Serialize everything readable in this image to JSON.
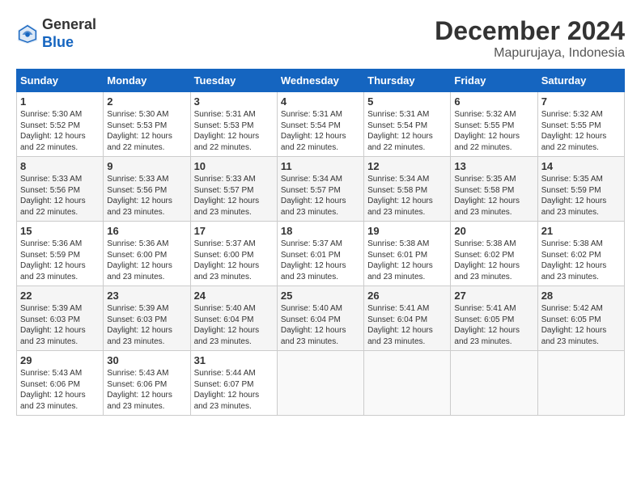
{
  "logo": {
    "general": "General",
    "blue": "Blue"
  },
  "title": "December 2024",
  "subtitle": "Mapurujaya, Indonesia",
  "headers": [
    "Sunday",
    "Monday",
    "Tuesday",
    "Wednesday",
    "Thursday",
    "Friday",
    "Saturday"
  ],
  "weeks": [
    [
      {
        "day": "1",
        "info": "Sunrise: 5:30 AM\nSunset: 5:52 PM\nDaylight: 12 hours\nand 22 minutes."
      },
      {
        "day": "2",
        "info": "Sunrise: 5:30 AM\nSunset: 5:53 PM\nDaylight: 12 hours\nand 22 minutes."
      },
      {
        "day": "3",
        "info": "Sunrise: 5:31 AM\nSunset: 5:53 PM\nDaylight: 12 hours\nand 22 minutes."
      },
      {
        "day": "4",
        "info": "Sunrise: 5:31 AM\nSunset: 5:54 PM\nDaylight: 12 hours\nand 22 minutes."
      },
      {
        "day": "5",
        "info": "Sunrise: 5:31 AM\nSunset: 5:54 PM\nDaylight: 12 hours\nand 22 minutes."
      },
      {
        "day": "6",
        "info": "Sunrise: 5:32 AM\nSunset: 5:55 PM\nDaylight: 12 hours\nand 22 minutes."
      },
      {
        "day": "7",
        "info": "Sunrise: 5:32 AM\nSunset: 5:55 PM\nDaylight: 12 hours\nand 22 minutes."
      }
    ],
    [
      {
        "day": "8",
        "info": "Sunrise: 5:33 AM\nSunset: 5:56 PM\nDaylight: 12 hours\nand 22 minutes."
      },
      {
        "day": "9",
        "info": "Sunrise: 5:33 AM\nSunset: 5:56 PM\nDaylight: 12 hours\nand 23 minutes."
      },
      {
        "day": "10",
        "info": "Sunrise: 5:33 AM\nSunset: 5:57 PM\nDaylight: 12 hours\nand 23 minutes."
      },
      {
        "day": "11",
        "info": "Sunrise: 5:34 AM\nSunset: 5:57 PM\nDaylight: 12 hours\nand 23 minutes."
      },
      {
        "day": "12",
        "info": "Sunrise: 5:34 AM\nSunset: 5:58 PM\nDaylight: 12 hours\nand 23 minutes."
      },
      {
        "day": "13",
        "info": "Sunrise: 5:35 AM\nSunset: 5:58 PM\nDaylight: 12 hours\nand 23 minutes."
      },
      {
        "day": "14",
        "info": "Sunrise: 5:35 AM\nSunset: 5:59 PM\nDaylight: 12 hours\nand 23 minutes."
      }
    ],
    [
      {
        "day": "15",
        "info": "Sunrise: 5:36 AM\nSunset: 5:59 PM\nDaylight: 12 hours\nand 23 minutes."
      },
      {
        "day": "16",
        "info": "Sunrise: 5:36 AM\nSunset: 6:00 PM\nDaylight: 12 hours\nand 23 minutes."
      },
      {
        "day": "17",
        "info": "Sunrise: 5:37 AM\nSunset: 6:00 PM\nDaylight: 12 hours\nand 23 minutes."
      },
      {
        "day": "18",
        "info": "Sunrise: 5:37 AM\nSunset: 6:01 PM\nDaylight: 12 hours\nand 23 minutes."
      },
      {
        "day": "19",
        "info": "Sunrise: 5:38 AM\nSunset: 6:01 PM\nDaylight: 12 hours\nand 23 minutes."
      },
      {
        "day": "20",
        "info": "Sunrise: 5:38 AM\nSunset: 6:02 PM\nDaylight: 12 hours\nand 23 minutes."
      },
      {
        "day": "21",
        "info": "Sunrise: 5:38 AM\nSunset: 6:02 PM\nDaylight: 12 hours\nand 23 minutes."
      }
    ],
    [
      {
        "day": "22",
        "info": "Sunrise: 5:39 AM\nSunset: 6:03 PM\nDaylight: 12 hours\nand 23 minutes."
      },
      {
        "day": "23",
        "info": "Sunrise: 5:39 AM\nSunset: 6:03 PM\nDaylight: 12 hours\nand 23 minutes."
      },
      {
        "day": "24",
        "info": "Sunrise: 5:40 AM\nSunset: 6:04 PM\nDaylight: 12 hours\nand 23 minutes."
      },
      {
        "day": "25",
        "info": "Sunrise: 5:40 AM\nSunset: 6:04 PM\nDaylight: 12 hours\nand 23 minutes."
      },
      {
        "day": "26",
        "info": "Sunrise: 5:41 AM\nSunset: 6:04 PM\nDaylight: 12 hours\nand 23 minutes."
      },
      {
        "day": "27",
        "info": "Sunrise: 5:41 AM\nSunset: 6:05 PM\nDaylight: 12 hours\nand 23 minutes."
      },
      {
        "day": "28",
        "info": "Sunrise: 5:42 AM\nSunset: 6:05 PM\nDaylight: 12 hours\nand 23 minutes."
      }
    ],
    [
      {
        "day": "29",
        "info": "Sunrise: 5:43 AM\nSunset: 6:06 PM\nDaylight: 12 hours\nand 23 minutes."
      },
      {
        "day": "30",
        "info": "Sunrise: 5:43 AM\nSunset: 6:06 PM\nDaylight: 12 hours\nand 23 minutes."
      },
      {
        "day": "31",
        "info": "Sunrise: 5:44 AM\nSunset: 6:07 PM\nDaylight: 12 hours\nand 23 minutes."
      },
      {
        "day": "",
        "info": ""
      },
      {
        "day": "",
        "info": ""
      },
      {
        "day": "",
        "info": ""
      },
      {
        "day": "",
        "info": ""
      }
    ]
  ]
}
